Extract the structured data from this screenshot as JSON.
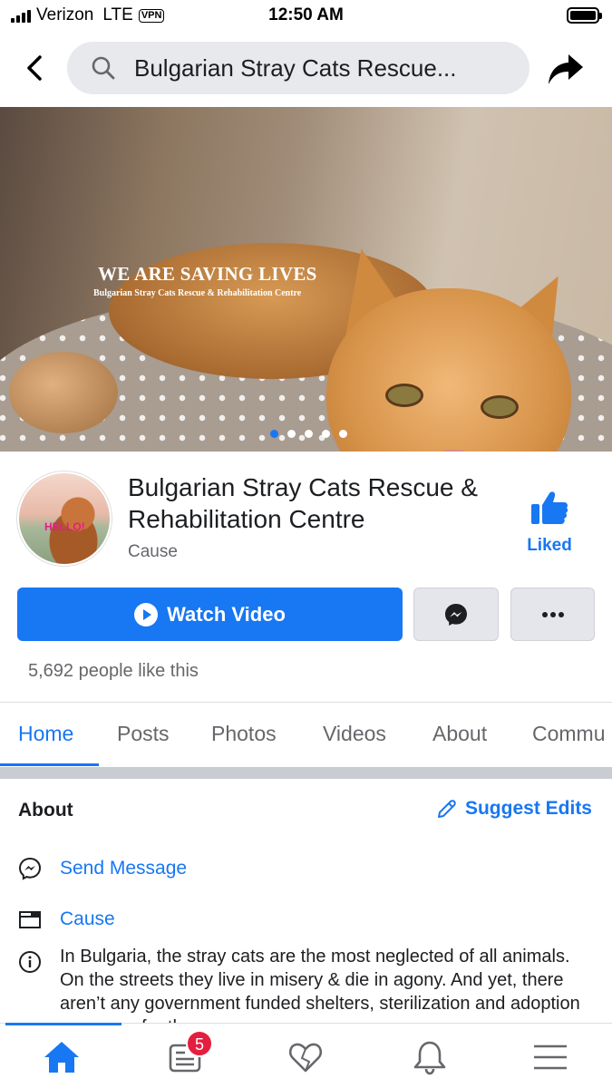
{
  "status_bar": {
    "carrier": "Verizon",
    "network": "LTE",
    "vpn": "VPN",
    "time": "12:50 AM"
  },
  "nav": {
    "search_text": "Bulgarian Stray Cats Rescue..."
  },
  "cover": {
    "title": "WE ARE SAVING LIVES",
    "subtitle": "Bulgarian Stray Cats Rescue & Rehabilitation Centre",
    "slide_count": 5,
    "active_slide": 1
  },
  "page": {
    "avatar_text": "HELLO!",
    "name": "Bulgarian Stray Cats Rescue & Rehabilitation Centre",
    "category": "Cause",
    "liked_label": "Liked",
    "watch_video_label": "Watch Video",
    "likes_count": "5,692 people like this"
  },
  "tabs": [
    "Home",
    "Posts",
    "Photos",
    "Videos",
    "About",
    "Commu"
  ],
  "active_tab": "Home",
  "about": {
    "heading": "About",
    "suggest_edits": "Suggest Edits",
    "send_message": "Send Message",
    "category_link": "Cause",
    "description": "In Bulgaria, the stray cats are the most neglected of all animals. On the streets they live in misery & die in agony. And yet, there aren’t any government funded shelters, sterilization and adoption programs for the"
  },
  "bottom_bar": {
    "items": [
      "home-icon",
      "news-feed-icon",
      "heart-icon",
      "bell-icon",
      "menu-icon"
    ],
    "notification_badge": "5"
  },
  "colors": {
    "accent": "#1877f2",
    "badge": "#e41e3f",
    "secondary_text": "#65676b"
  }
}
